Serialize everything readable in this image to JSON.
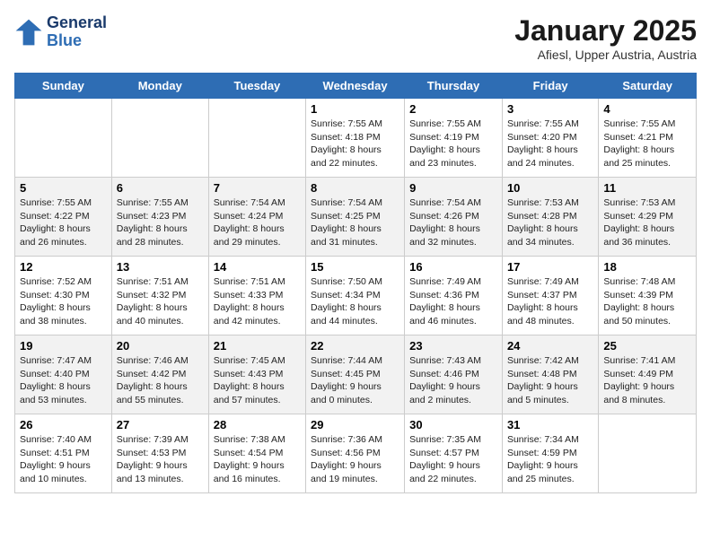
{
  "header": {
    "logo_general": "General",
    "logo_blue": "Blue",
    "title": "January 2025",
    "subtitle": "Afiesl, Upper Austria, Austria"
  },
  "columns": [
    "Sunday",
    "Monday",
    "Tuesday",
    "Wednesday",
    "Thursday",
    "Friday",
    "Saturday"
  ],
  "weeks": [
    {
      "cells": [
        {
          "day": "",
          "content": ""
        },
        {
          "day": "",
          "content": ""
        },
        {
          "day": "",
          "content": ""
        },
        {
          "day": "1",
          "content": "Sunrise: 7:55 AM\nSunset: 4:18 PM\nDaylight: 8 hours\nand 22 minutes."
        },
        {
          "day": "2",
          "content": "Sunrise: 7:55 AM\nSunset: 4:19 PM\nDaylight: 8 hours\nand 23 minutes."
        },
        {
          "day": "3",
          "content": "Sunrise: 7:55 AM\nSunset: 4:20 PM\nDaylight: 8 hours\nand 24 minutes."
        },
        {
          "day": "4",
          "content": "Sunrise: 7:55 AM\nSunset: 4:21 PM\nDaylight: 8 hours\nand 25 minutes."
        }
      ]
    },
    {
      "cells": [
        {
          "day": "5",
          "content": "Sunrise: 7:55 AM\nSunset: 4:22 PM\nDaylight: 8 hours\nand 26 minutes."
        },
        {
          "day": "6",
          "content": "Sunrise: 7:55 AM\nSunset: 4:23 PM\nDaylight: 8 hours\nand 28 minutes."
        },
        {
          "day": "7",
          "content": "Sunrise: 7:54 AM\nSunset: 4:24 PM\nDaylight: 8 hours\nand 29 minutes."
        },
        {
          "day": "8",
          "content": "Sunrise: 7:54 AM\nSunset: 4:25 PM\nDaylight: 8 hours\nand 31 minutes."
        },
        {
          "day": "9",
          "content": "Sunrise: 7:54 AM\nSunset: 4:26 PM\nDaylight: 8 hours\nand 32 minutes."
        },
        {
          "day": "10",
          "content": "Sunrise: 7:53 AM\nSunset: 4:28 PM\nDaylight: 8 hours\nand 34 minutes."
        },
        {
          "day": "11",
          "content": "Sunrise: 7:53 AM\nSunset: 4:29 PM\nDaylight: 8 hours\nand 36 minutes."
        }
      ]
    },
    {
      "cells": [
        {
          "day": "12",
          "content": "Sunrise: 7:52 AM\nSunset: 4:30 PM\nDaylight: 8 hours\nand 38 minutes."
        },
        {
          "day": "13",
          "content": "Sunrise: 7:51 AM\nSunset: 4:32 PM\nDaylight: 8 hours\nand 40 minutes."
        },
        {
          "day": "14",
          "content": "Sunrise: 7:51 AM\nSunset: 4:33 PM\nDaylight: 8 hours\nand 42 minutes."
        },
        {
          "day": "15",
          "content": "Sunrise: 7:50 AM\nSunset: 4:34 PM\nDaylight: 8 hours\nand 44 minutes."
        },
        {
          "day": "16",
          "content": "Sunrise: 7:49 AM\nSunset: 4:36 PM\nDaylight: 8 hours\nand 46 minutes."
        },
        {
          "day": "17",
          "content": "Sunrise: 7:49 AM\nSunset: 4:37 PM\nDaylight: 8 hours\nand 48 minutes."
        },
        {
          "day": "18",
          "content": "Sunrise: 7:48 AM\nSunset: 4:39 PM\nDaylight: 8 hours\nand 50 minutes."
        }
      ]
    },
    {
      "cells": [
        {
          "day": "19",
          "content": "Sunrise: 7:47 AM\nSunset: 4:40 PM\nDaylight: 8 hours\nand 53 minutes."
        },
        {
          "day": "20",
          "content": "Sunrise: 7:46 AM\nSunset: 4:42 PM\nDaylight: 8 hours\nand 55 minutes."
        },
        {
          "day": "21",
          "content": "Sunrise: 7:45 AM\nSunset: 4:43 PM\nDaylight: 8 hours\nand 57 minutes."
        },
        {
          "day": "22",
          "content": "Sunrise: 7:44 AM\nSunset: 4:45 PM\nDaylight: 9 hours\nand 0 minutes."
        },
        {
          "day": "23",
          "content": "Sunrise: 7:43 AM\nSunset: 4:46 PM\nDaylight: 9 hours\nand 2 minutes."
        },
        {
          "day": "24",
          "content": "Sunrise: 7:42 AM\nSunset: 4:48 PM\nDaylight: 9 hours\nand 5 minutes."
        },
        {
          "day": "25",
          "content": "Sunrise: 7:41 AM\nSunset: 4:49 PM\nDaylight: 9 hours\nand 8 minutes."
        }
      ]
    },
    {
      "cells": [
        {
          "day": "26",
          "content": "Sunrise: 7:40 AM\nSunset: 4:51 PM\nDaylight: 9 hours\nand 10 minutes."
        },
        {
          "day": "27",
          "content": "Sunrise: 7:39 AM\nSunset: 4:53 PM\nDaylight: 9 hours\nand 13 minutes."
        },
        {
          "day": "28",
          "content": "Sunrise: 7:38 AM\nSunset: 4:54 PM\nDaylight: 9 hours\nand 16 minutes."
        },
        {
          "day": "29",
          "content": "Sunrise: 7:36 AM\nSunset: 4:56 PM\nDaylight: 9 hours\nand 19 minutes."
        },
        {
          "day": "30",
          "content": "Sunrise: 7:35 AM\nSunset: 4:57 PM\nDaylight: 9 hours\nand 22 minutes."
        },
        {
          "day": "31",
          "content": "Sunrise: 7:34 AM\nSunset: 4:59 PM\nDaylight: 9 hours\nand 25 minutes."
        },
        {
          "day": "",
          "content": ""
        }
      ]
    }
  ]
}
